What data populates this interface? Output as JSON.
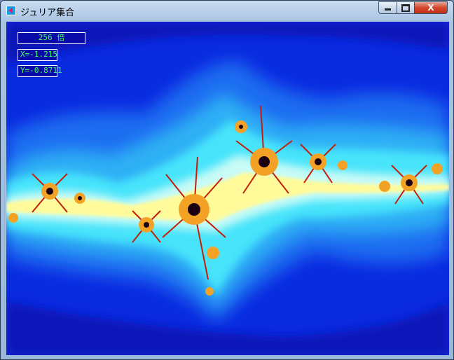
{
  "window": {
    "title": "ジュリア集合",
    "icon": "julia-app-icon",
    "controls": {
      "minimize_icon": "minimize-icon",
      "maximize_icon": "maximize-icon",
      "close_label": "X"
    }
  },
  "overlay": {
    "zoom": "256 倍",
    "x": "X=-1.215",
    "y": "Y=-0.8711"
  },
  "colors": {
    "deep_blue": "#001a8c",
    "blue": "#0a2ae0",
    "mid_blue": "#1a6cf0",
    "light_blue": "#2fb0f5",
    "cyan": "#46e4fb",
    "pale": "#c8fbf6",
    "yellow": "#fffb9a",
    "orange": "#f3a226",
    "red": "#c41e0a",
    "dark": "#1a0010"
  }
}
